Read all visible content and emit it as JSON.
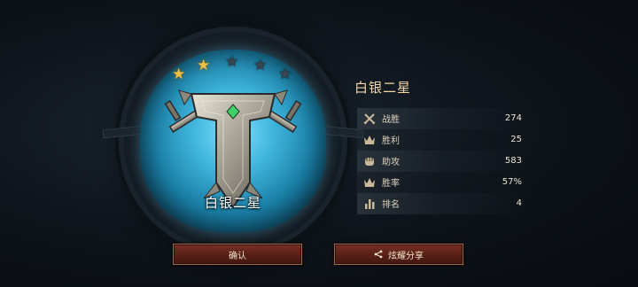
{
  "emblem": {
    "stars": [
      {
        "filled": true
      },
      {
        "filled": true
      },
      {
        "filled": false
      },
      {
        "filled": false
      },
      {
        "filled": false
      }
    ],
    "rank_label": "白银二星"
  },
  "panel": {
    "rank_title": "白银二星",
    "stats": [
      {
        "label": "战胜",
        "value": "274",
        "icon": "crossed-swords-icon"
      },
      {
        "label": "胜利",
        "value": "25",
        "icon": "crown-icon"
      },
      {
        "label": "助攻",
        "value": "583",
        "icon": "fist-icon"
      },
      {
        "label": "胜率",
        "value": "57%",
        "icon": "crown-icon"
      },
      {
        "label": "排名",
        "value": "4",
        "icon": "bar-chart-icon"
      }
    ]
  },
  "buttons": {
    "confirm_label": "确认",
    "share_label": "炫耀分享"
  },
  "colors": {
    "star_gold": "#f0c040",
    "button_red": "#5a2117",
    "disc_blue": "#3fb5dc"
  }
}
